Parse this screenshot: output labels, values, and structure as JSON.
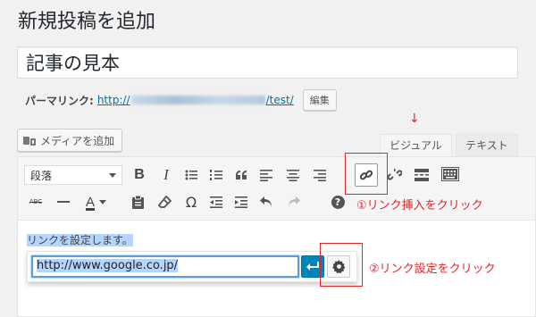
{
  "page": {
    "title": "新規投稿を追加"
  },
  "post": {
    "title_value": "記事の見本"
  },
  "permalink": {
    "label": "パーマリンク:",
    "url_prefix": "http://",
    "url_suffix": "/test/",
    "edit_button": "編集"
  },
  "media": {
    "add_button": "メディアを追加"
  },
  "tabs": {
    "arrow": "↓",
    "visual": "ビジュアル",
    "text": "テキスト"
  },
  "toolbar": {
    "format_select": "段落",
    "row1": [
      "bold-icon",
      "italic-icon",
      "bullet-list-icon",
      "numbered-list-icon",
      "blockquote-icon",
      "align-left-icon",
      "align-center-icon",
      "align-right-icon",
      "insert-link-icon",
      "unlink-icon",
      "read-more-icon",
      "toolbar-toggle-icon"
    ],
    "row2": [
      "strikethrough-icon",
      "horizontal-line-icon",
      "text-color-icon",
      "paste-as-text-icon",
      "clear-formatting-icon",
      "special-character-icon",
      "outdent-icon",
      "indent-icon",
      "undo-icon",
      "redo-icon",
      "help-icon"
    ],
    "labels": {
      "bold": "B",
      "italic": "I",
      "abc": "ABC",
      "text_color": "A",
      "omega": "Ω",
      "help": "?"
    }
  },
  "content": {
    "selected_text": "リンクを設定します。"
  },
  "link_popup": {
    "url_value": "http://www.google.co.jp/"
  },
  "annotations": {
    "step1": "①リンク挿入をクリック",
    "step2": "②リンク設定をクリック",
    "color": "#e0252b"
  }
}
